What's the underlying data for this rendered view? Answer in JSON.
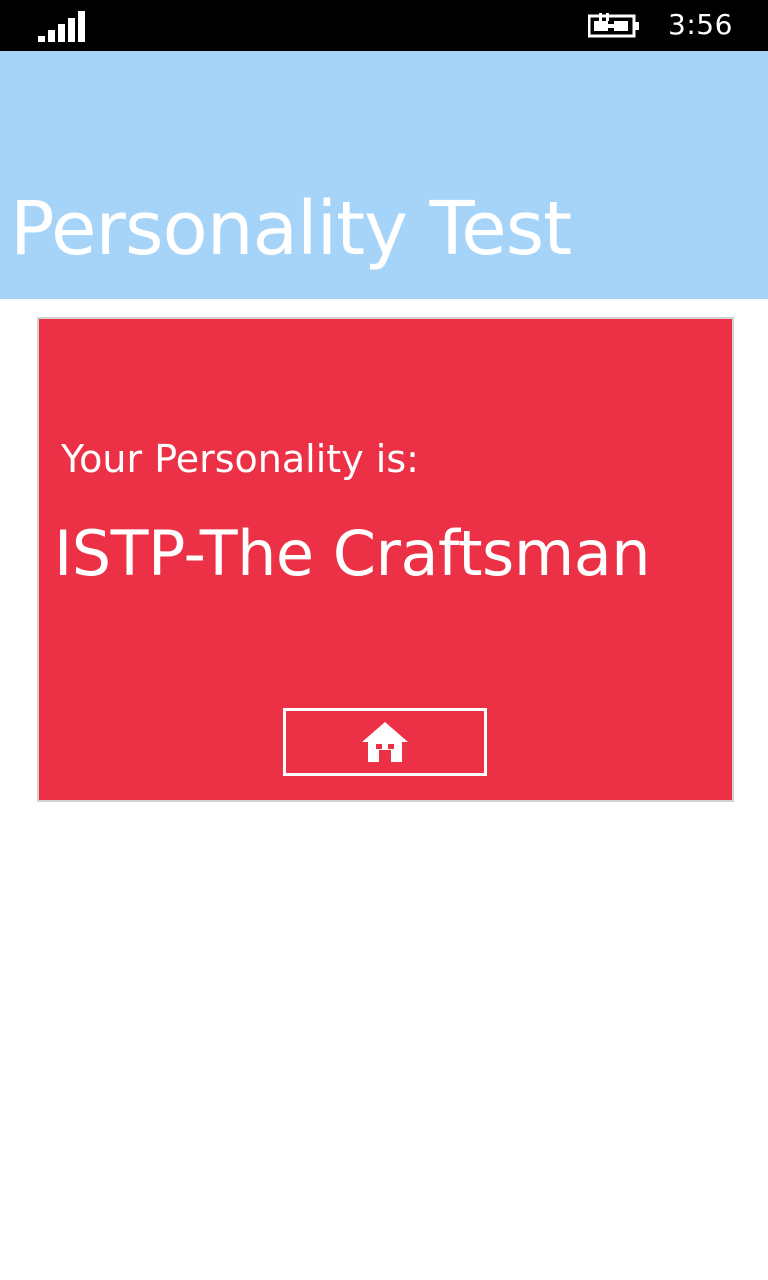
{
  "status_bar": {
    "time": "3:56",
    "signal_icon": "signal-strength-icon",
    "battery_icon": "battery-charging-icon"
  },
  "header": {
    "title": "Personality Test",
    "background_color": "#a6d4f8"
  },
  "result": {
    "label": "Your Personality is:",
    "value": "ISTP-The Craftsman",
    "card_color": "#ec3146"
  },
  "home_button": {
    "icon": "home-icon"
  }
}
